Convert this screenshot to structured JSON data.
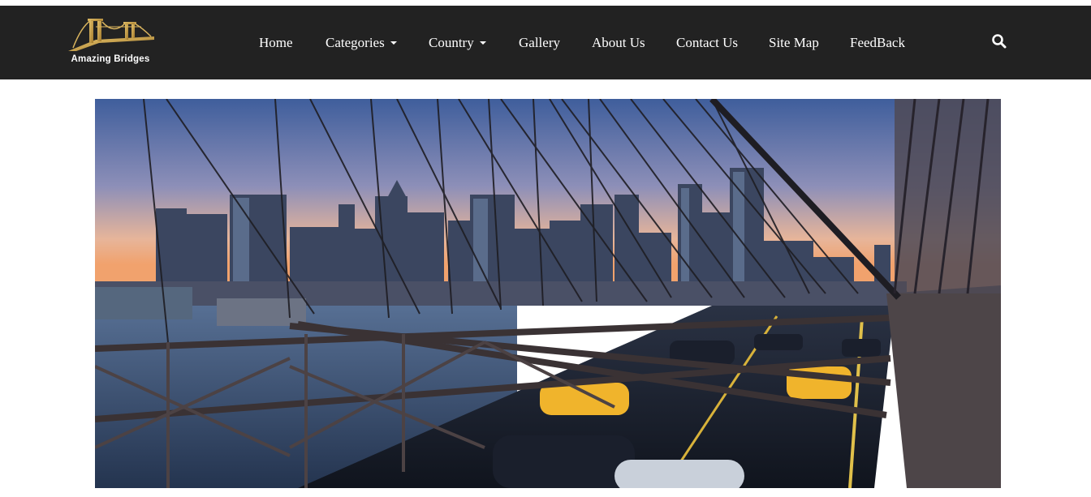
{
  "brand": {
    "logo_text": "Amazing Bridges",
    "logo_icon": "bridge-logo-icon",
    "logo_color": "#c9a24a"
  },
  "nav": {
    "items": [
      {
        "label": "Home",
        "has_dropdown": false
      },
      {
        "label": "Categories",
        "has_dropdown": true
      },
      {
        "label": "Country",
        "has_dropdown": true
      },
      {
        "label": "Gallery",
        "has_dropdown": false
      },
      {
        "label": "About Us",
        "has_dropdown": false
      },
      {
        "label": "Contact Us",
        "has_dropdown": false
      },
      {
        "label": "Site Map",
        "has_dropdown": false
      },
      {
        "label": "FeedBack",
        "has_dropdown": false
      }
    ],
    "search_icon": "search-icon",
    "background": "#222222",
    "text_color": "#ffffff"
  },
  "hero": {
    "image_subject": "city skyline seen through suspension bridge cables at dusk, with taxis on the roadway"
  }
}
